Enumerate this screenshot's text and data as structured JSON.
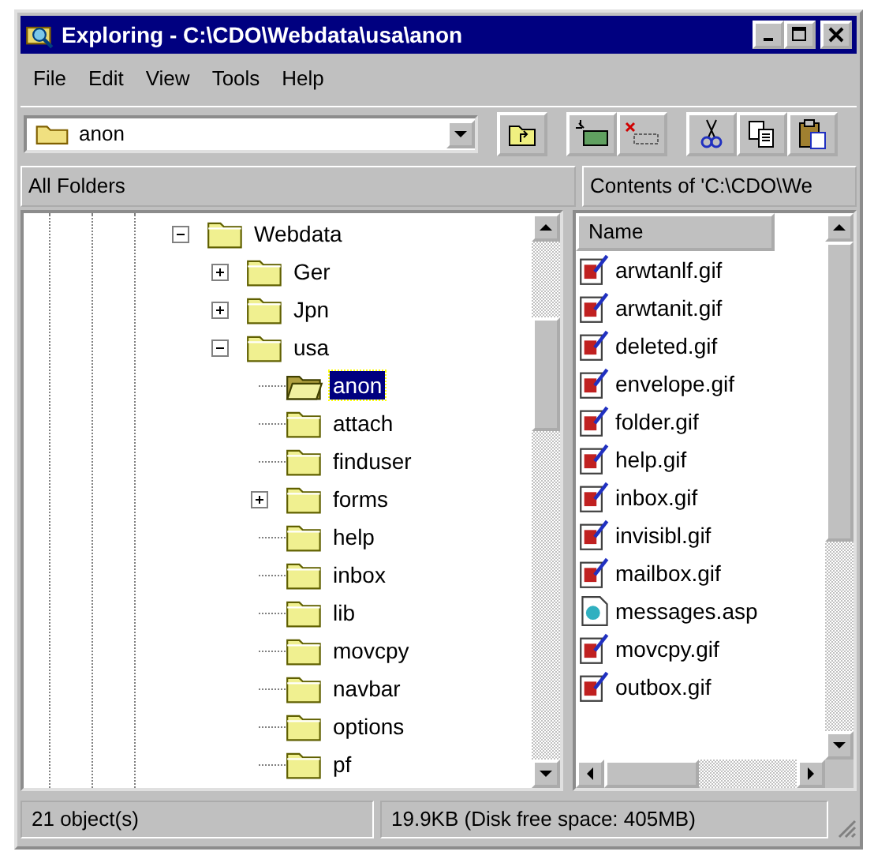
{
  "window": {
    "title": "Exploring - C:\\CDO\\Webdata\\usa\\anon"
  },
  "menu": [
    "File",
    "Edit",
    "View",
    "Tools",
    "Help"
  ],
  "toolbar": {
    "address": "anon"
  },
  "panes": {
    "left_header": "All Folders",
    "right_header": "Contents of 'C:\\CDO\\We"
  },
  "tree": [
    {
      "label": "Webdata",
      "expandable": true,
      "expanded": true,
      "selected": false,
      "children": [
        {
          "label": "Ger",
          "expandable": true,
          "expanded": false,
          "selected": false
        },
        {
          "label": "Jpn",
          "expandable": true,
          "expanded": false,
          "selected": false
        },
        {
          "label": "usa",
          "expandable": true,
          "expanded": true,
          "selected": false,
          "children": [
            {
              "label": "anon",
              "expandable": false,
              "selected": true
            },
            {
              "label": "attach",
              "expandable": false,
              "selected": false
            },
            {
              "label": "finduser",
              "expandable": false,
              "selected": false
            },
            {
              "label": "forms",
              "expandable": true,
              "expanded": false,
              "selected": false
            },
            {
              "label": "help",
              "expandable": false,
              "selected": false
            },
            {
              "label": "inbox",
              "expandable": false,
              "selected": false
            },
            {
              "label": "lib",
              "expandable": false,
              "selected": false
            },
            {
              "label": "movcpy",
              "expandable": false,
              "selected": false
            },
            {
              "label": "navbar",
              "expandable": false,
              "selected": false
            },
            {
              "label": "options",
              "expandable": false,
              "selected": false
            },
            {
              "label": "pf",
              "expandable": false,
              "selected": false
            }
          ]
        }
      ]
    }
  ],
  "file_list": {
    "column": "Name",
    "files": [
      {
        "name": "arwtanlf.gif",
        "kind": "image"
      },
      {
        "name": "arwtanit.gif",
        "kind": "image"
      },
      {
        "name": "deleted.gif",
        "kind": "image"
      },
      {
        "name": "envelope.gif",
        "kind": "image"
      },
      {
        "name": "folder.gif",
        "kind": "image"
      },
      {
        "name": "help.gif",
        "kind": "image"
      },
      {
        "name": "inbox.gif",
        "kind": "image"
      },
      {
        "name": "invisibl.gif",
        "kind": "image"
      },
      {
        "name": "mailbox.gif",
        "kind": "image"
      },
      {
        "name": "messages.asp",
        "kind": "script"
      },
      {
        "name": "movcpy.gif",
        "kind": "image"
      },
      {
        "name": "outbox.gif",
        "kind": "image"
      }
    ]
  },
  "status_bar": [
    "21 object(s)",
    "19.9KB (Disk free space: 405MB)"
  ]
}
